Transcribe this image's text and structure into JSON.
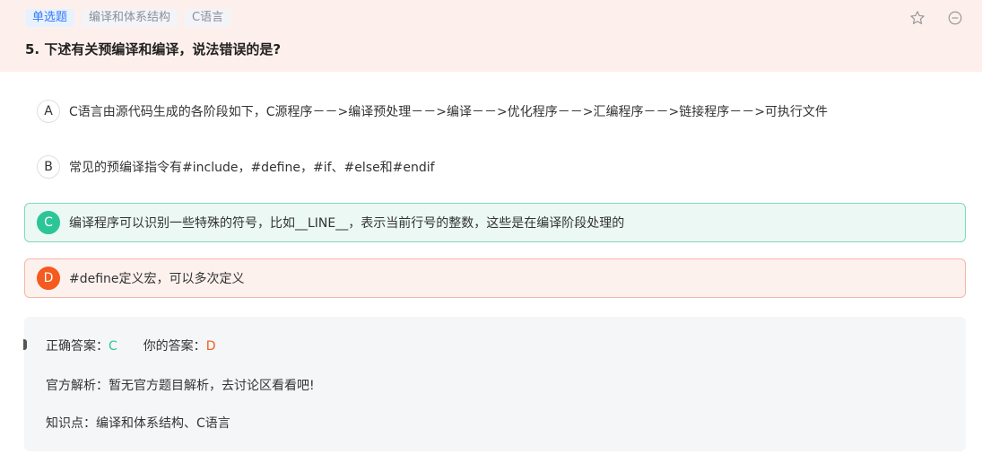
{
  "tags": [
    "单选题",
    "编译和体系结构",
    "C语言"
  ],
  "question": {
    "title": "5. 下述有关预编译和编译，说法错误的是?"
  },
  "header_icons": [
    "star-icon",
    "minus-circle-icon"
  ],
  "options": [
    {
      "letter": "A",
      "text": "C语言由源代码生成的各阶段如下，C源程序－－>编译预处理－－>编译－－>优化程序－－>汇编程序－－>链接程序－－>可执行文件",
      "state": "normal"
    },
    {
      "letter": "B",
      "text": "常见的预编译指令有#include，#define，#if、#else和#endif",
      "state": "normal"
    },
    {
      "letter": "C",
      "text": "编译程序可以识别一些特殊的符号，比如__LINE__，表示当前行号的整数，这些是在编译阶段处理的",
      "state": "correct"
    },
    {
      "letter": "D",
      "text": "#define定义宏，可以多次定义",
      "state": "wrong"
    }
  ],
  "analysis": {
    "correct_label": "正确答案：",
    "correct_value": "C",
    "your_label": "你的答案：",
    "your_value": "D",
    "official": "官方解析：暂无官方题目解析，去讨论区看看吧!",
    "knowledge": "知识点：编译和体系结构、C语言"
  },
  "colors": {
    "header_bg": "#fdf0ec",
    "correct": "#2dc597",
    "wrong": "#f55a1e",
    "tag_primary": "#3478f6"
  }
}
